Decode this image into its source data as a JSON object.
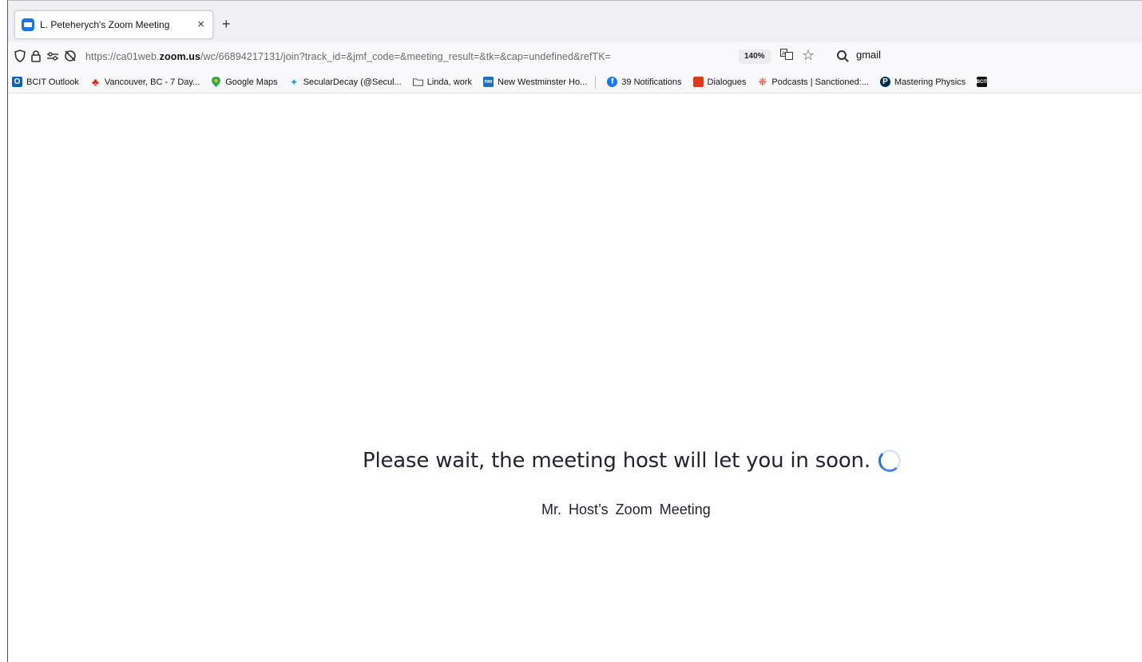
{
  "tab": {
    "title": "L. Peteherych's Zoom Meeting",
    "close": "×",
    "new_tab": "+"
  },
  "navbar": {
    "url_prefix": "https://ca01web.",
    "url_domain": "zoom.us",
    "url_suffix": "/wc/66894217131/join?track_id=&jmf_code=&meeting_result=&tk=&cap=undefined&refTK=",
    "zoom_level": "140%",
    "search_text": "gmail"
  },
  "bookmarks": [
    {
      "label": "BCIT Outlook",
      "icon": "outlook-icon",
      "color": "#0f62b3"
    },
    {
      "label": "Vancouver, BC - 7 Day...",
      "icon": "maple-leaf-icon",
      "color": "#d52b1e"
    },
    {
      "label": "Google Maps",
      "icon": "map-pin-icon",
      "color": "#34a853"
    },
    {
      "label": "SecularDecay (@Secul...",
      "icon": "twitter-icon",
      "color": "#1d9bf0"
    },
    {
      "label": "Linda, work",
      "icon": "folder-icon",
      "color": "#444444"
    },
    {
      "label": "New Westminster Ho...",
      "icon": "nw-icon",
      "color": "#1e6fb8"
    },
    {
      "label": "39 Notifications",
      "icon": "facebook-icon",
      "color": "#1877f2"
    },
    {
      "label": "Dialogues",
      "icon": "dialogues-icon",
      "color": "#e03a1e"
    },
    {
      "label": "Podcasts | Sanctioned:...",
      "icon": "cbc-icon",
      "color": "#d52b1e"
    },
    {
      "label": "Mastering Physics",
      "icon": "pearson-icon",
      "color": "#003057"
    },
    {
      "label": "",
      "icon": "bcit-icon",
      "color": "#111111"
    }
  ],
  "content": {
    "wait_message": "Please wait, the meeting host will let you in soon.",
    "meeting_name": "Mr. Host’s Zoom Meeting"
  },
  "colors": {
    "spinner": "#2d6fdc",
    "zoom_brand": "#1a73e8"
  }
}
